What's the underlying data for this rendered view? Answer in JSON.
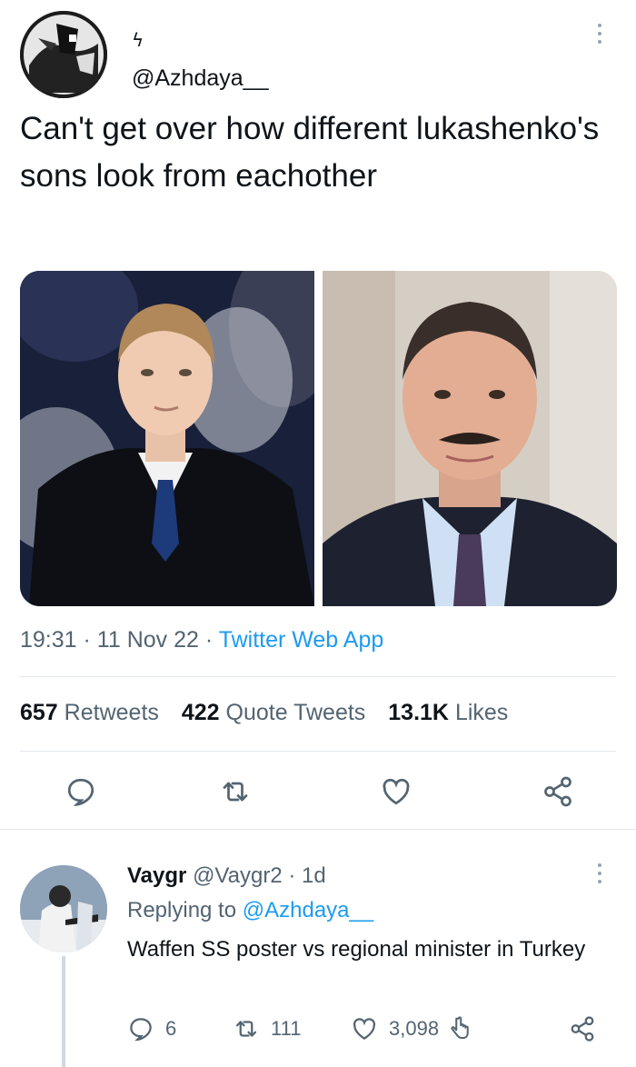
{
  "tweet": {
    "display_name_glyph": "ϟ",
    "handle": "@Azhdaya__",
    "text": "Can't get over how different lukashenko's sons look from eachother",
    "time": "19:31",
    "date": "11 Nov 22",
    "app": "Twitter Web App",
    "retweets_count": "657",
    "retweets_label": "Retweets",
    "quotes_count": "422",
    "quotes_label": "Quote Tweets",
    "likes_count": "13.1K",
    "likes_label": "Likes",
    "icons": {
      "more": "more-icon",
      "reply": "reply-icon",
      "retweet": "retweet-icon",
      "like": "heart-icon",
      "share": "share-icon"
    }
  },
  "reply": {
    "name": "Vaygr",
    "handle": "@Vaygr2",
    "age": "1d",
    "replying_prefix": "Replying to",
    "replying_to": "@Azhdaya__",
    "text": "Waffen SS poster vs regional minister in Turkey",
    "reply_count": "6",
    "retweet_count": "111",
    "like_count": "3,098"
  },
  "colors": {
    "accent": "#1d9bf0",
    "secondary_text": "#536471",
    "primary_text": "#0f1419",
    "divider": "#e3e7ea"
  }
}
